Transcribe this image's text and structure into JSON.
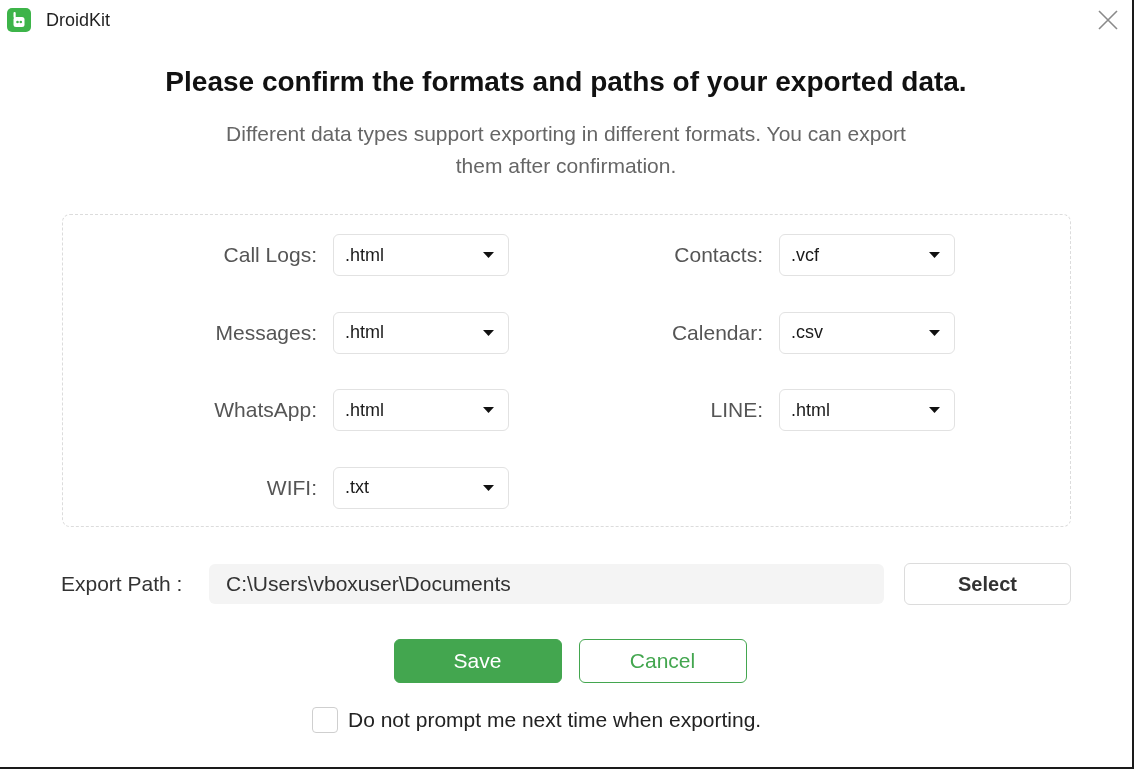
{
  "window": {
    "title": "DroidKit"
  },
  "heading": "Please confirm the formats and paths of your exported data.",
  "description": "Different data types support exporting in different formats. You can export them after confirmation.",
  "formats": [
    {
      "label": "Call Logs:",
      "value": ".html"
    },
    {
      "label": "Contacts:",
      "value": ".vcf"
    },
    {
      "label": "Messages:",
      "value": ".html"
    },
    {
      "label": "Calendar:",
      "value": ".csv"
    },
    {
      "label": "WhatsApp:",
      "value": ".html"
    },
    {
      "label": "LINE:",
      "value": ".html"
    },
    {
      "label": "WIFI:",
      "value": ".txt"
    }
  ],
  "export_path": {
    "label": "Export Path :",
    "value": "C:\\Users\\vboxuser\\Documents",
    "button": "Select"
  },
  "buttons": [
    {
      "label": "Save",
      "kind": "primary"
    },
    {
      "label": "Cancel",
      "kind": "secondary"
    }
  ],
  "dont_prompt": {
    "label": "Do not prompt me next time when exporting.",
    "checked": false
  }
}
